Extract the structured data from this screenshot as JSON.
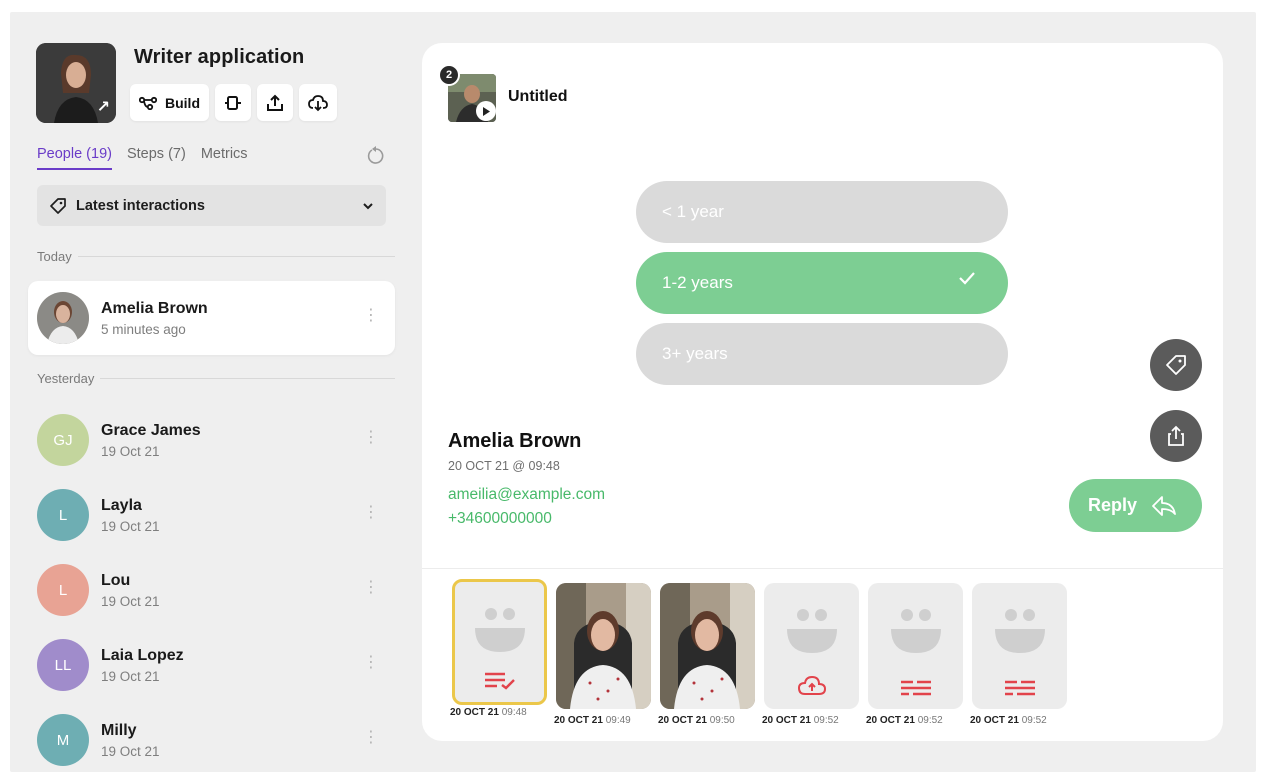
{
  "app": {
    "title": "Writer application",
    "build_label": "Build"
  },
  "tabs": [
    {
      "label": "People (19)"
    },
    {
      "label": "Steps (7)"
    },
    {
      "label": "Metrics"
    }
  ],
  "filter": {
    "label": "Latest interactions"
  },
  "sections": {
    "today": "Today",
    "yesterday": "Yesterday"
  },
  "people": [
    {
      "name": "Amelia Brown",
      "time": "5 minutes ago",
      "initials": "",
      "color": "#d9d4cf"
    },
    {
      "name": "Grace James",
      "time": "19 Oct 21",
      "initials": "GJ",
      "color": "#c3d59d"
    },
    {
      "name": "Layla",
      "time": "19 Oct 21",
      "initials": "L",
      "color": "#6eaeb3"
    },
    {
      "name": "Lou",
      "time": "19 Oct 21",
      "initials": "L",
      "color": "#e8a394"
    },
    {
      "name": "Laia Lopez",
      "time": "19 Oct 21",
      "initials": "LL",
      "color": "#a08ccb"
    },
    {
      "name": "Milly",
      "time": "19 Oct 21",
      "initials": "M",
      "color": "#6eaeb3"
    }
  ],
  "document": {
    "badge": "2",
    "title": "Untitled"
  },
  "options": [
    {
      "label": "< 1 year",
      "selected": false
    },
    {
      "label": "1-2 years",
      "selected": true
    },
    {
      "label": "3+ years",
      "selected": false
    }
  ],
  "contact": {
    "name": "Amelia Brown",
    "date": "20 OCT 21 @ 09:48",
    "email": "ameilia@example.com",
    "phone": "+34600000000"
  },
  "reply_label": "Reply",
  "tiles": [
    {
      "date": "20 OCT 21",
      "time": "09:48",
      "kind": "face",
      "icon": "list-check-icon",
      "selected": true
    },
    {
      "date": "20 OCT 21",
      "time": "09:49",
      "kind": "photo",
      "icon": "",
      "selected": false
    },
    {
      "date": "20 OCT 21",
      "time": "09:50",
      "kind": "photo",
      "icon": "",
      "selected": false
    },
    {
      "date": "20 OCT 21",
      "time": "09:52",
      "kind": "face",
      "icon": "cloud-upload-icon",
      "selected": false
    },
    {
      "date": "20 OCT 21",
      "time": "09:52",
      "kind": "face",
      "icon": "text-lines-icon",
      "selected": false
    },
    {
      "date": "20 OCT 21",
      "time": "09:52",
      "kind": "face",
      "icon": "text-lines-icon",
      "selected": false
    }
  ],
  "colors": {
    "accent": "#6a3cc8",
    "green": "#7dce93",
    "green_text": "#48b96a",
    "selection": "#ebc74a",
    "icon_red": "#e2434b"
  }
}
